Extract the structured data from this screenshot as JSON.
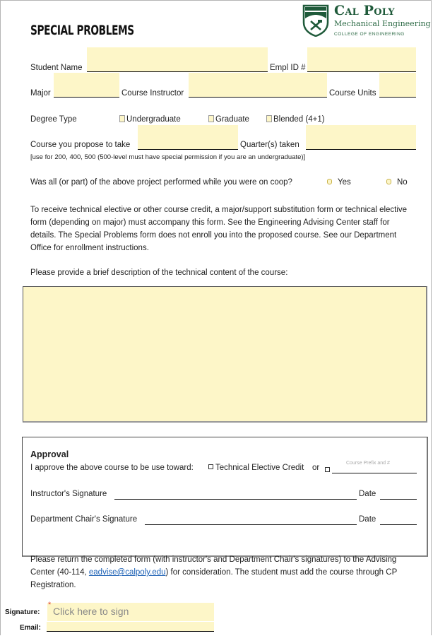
{
  "header": {
    "title": "SPECIAL PROBLEMS",
    "logo": {
      "icon": "cal-poly-shield-icon",
      "name": "Cal Poly",
      "department": "Mechanical Engineering",
      "college": "COLLEGE OF ENGINEERING"
    }
  },
  "fields": {
    "student_name": {
      "label": "Student Name",
      "value": ""
    },
    "empl_id": {
      "label": "Empl ID #",
      "value": ""
    },
    "major": {
      "label": "Major",
      "value": ""
    },
    "course_instructor": {
      "label": "Course Instructor",
      "value": ""
    },
    "course_units": {
      "label": "Course Units",
      "value": ""
    },
    "course_propose": {
      "label": "Course you propose to take",
      "value": ""
    },
    "quarters_taken": {
      "label": "Quarter(s) taken",
      "value": ""
    }
  },
  "degree_type": {
    "label": "Degree Type",
    "options": [
      {
        "label": "Undergraduate",
        "checked": false
      },
      {
        "label": "Graduate",
        "checked": false
      },
      {
        "label": "Blended (4+1)",
        "checked": false
      }
    ]
  },
  "course_note": "[use for 200, 400, 500 (500-level must have special permission if you are an undergraduate)]",
  "coop": {
    "question": "Was all (or part) of the above project performed while you were on coop?",
    "options": [
      {
        "label": "Yes",
        "selected": false
      },
      {
        "label": "No",
        "selected": false
      }
    ]
  },
  "info_paragraph": "To receive technical elective or other course credit, a major/support substitution form or technical elective form (depending on major) must accompany this form. See the Engineering Advising Center staff for details. The Special Problems form does not enroll you into the proposed course.  See our Department Office for enrollment instructions.",
  "description": {
    "prompt": "Please provide a brief description of the technical content of the course:",
    "value": ""
  },
  "approval": {
    "heading": "Approval",
    "statement": "I approve the above course to be use toward:",
    "option_tech": "Technical Elective Credit",
    "or_label": "or",
    "course_prefix_placeholder": "Course Prefix and #",
    "instructor_sig_label": "Instructor's Signature",
    "chair_sig_label": "Department Chair's Signature",
    "date_label": "Date"
  },
  "footer": {
    "text_before": "Please return the completed form (with instructor's and Department Chair's signatures) to the Advising Center (40-114, ",
    "email_link": "eadvise@calpoly.edu",
    "text_after": ") for consideration.  The student must add the course through CP Registration."
  },
  "signing": {
    "signature_label": "Signature:",
    "signature_placeholder": "Click here to sign",
    "required_mark": "*",
    "email_label": "Email:",
    "email_value": ""
  }
}
